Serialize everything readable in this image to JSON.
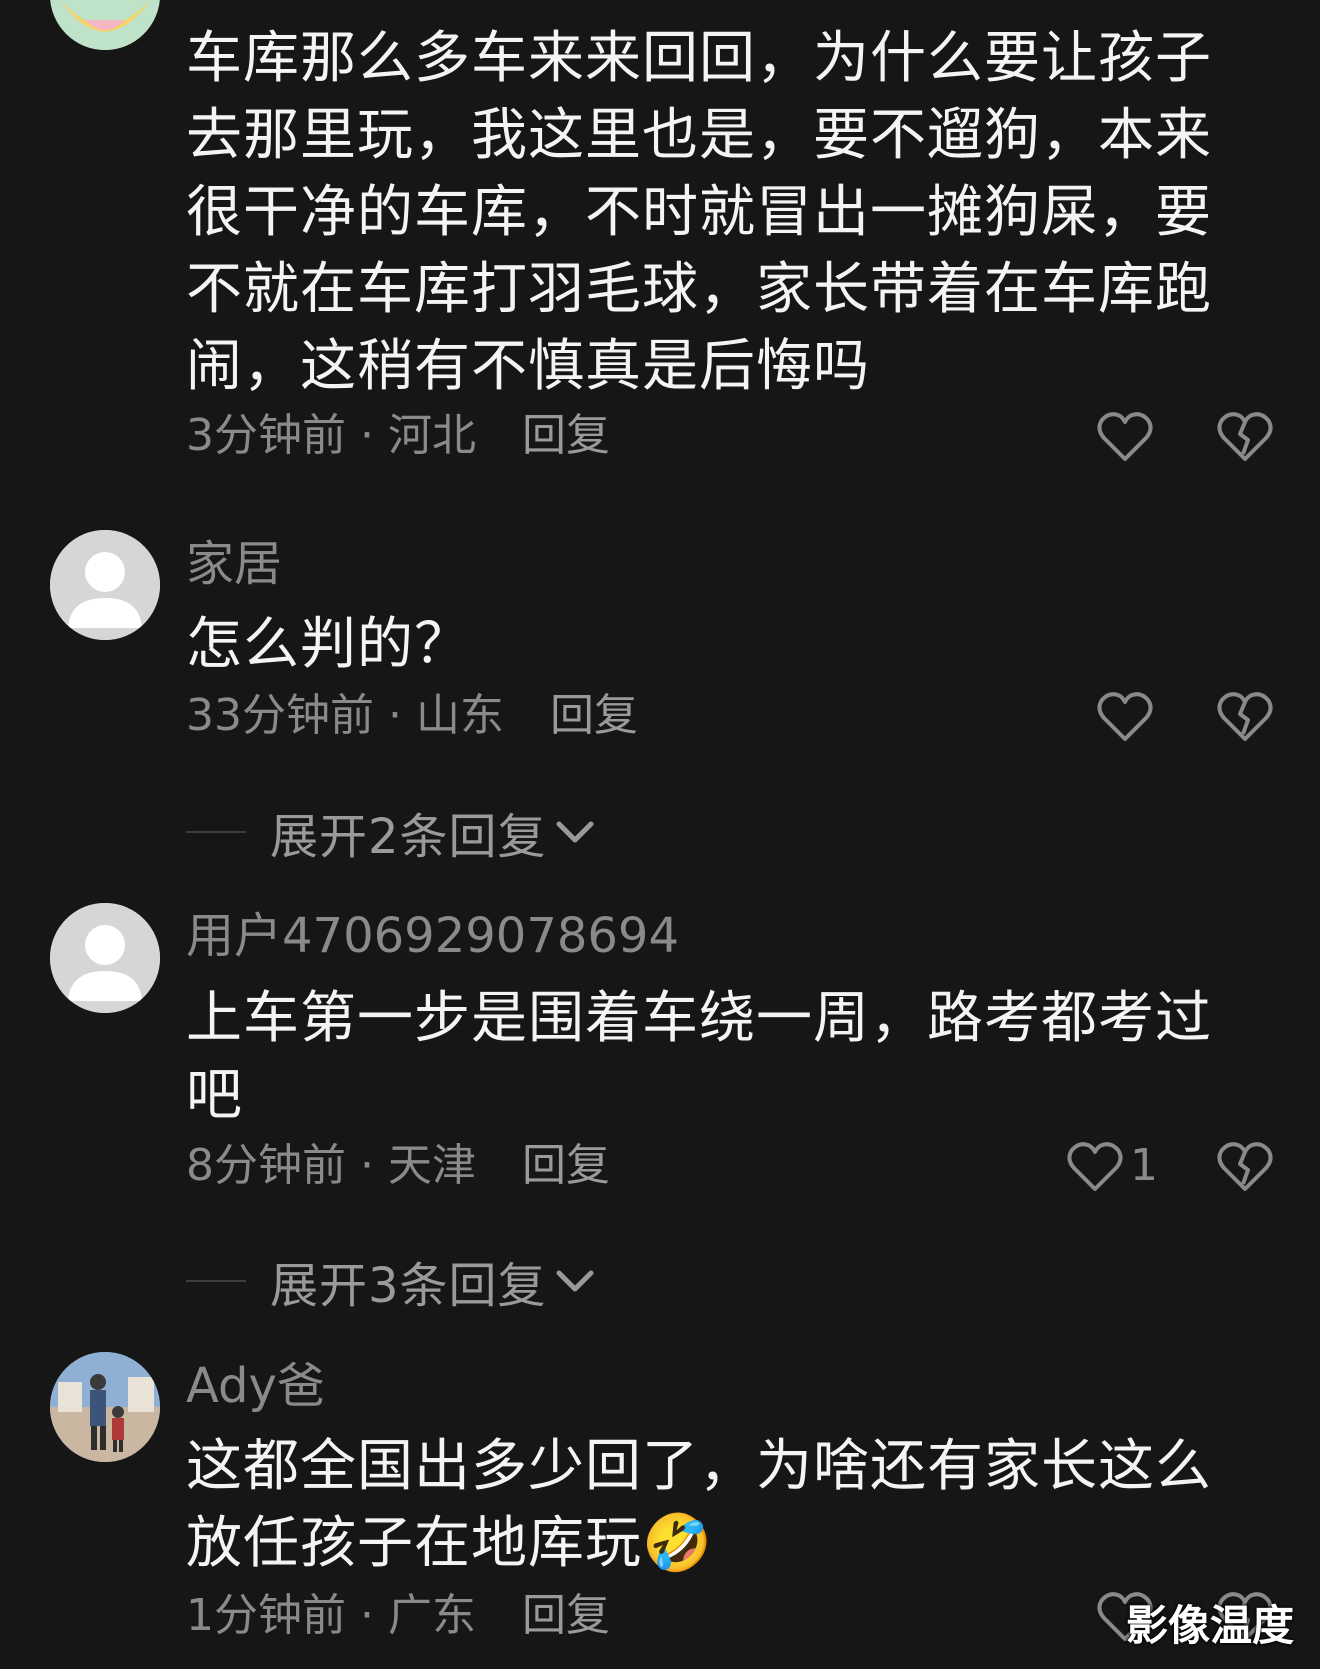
{
  "comments": [
    {
      "username": "",
      "text": "车库那么多车来来回回，为什么要让孩子去那里玩，我这里也是，要不遛狗，本来很干净的车库，不时就冒出一摊狗屎，要不就在车库打羽毛球，家长带着在车库跑闹，这稍有不慎真是后悔吗",
      "meta": "3分钟前 · 河北",
      "reply": "回复",
      "likes": ""
    },
    {
      "username": "家居",
      "text": "怎么判的？",
      "meta": "33分钟前 · 山东",
      "reply": "回复",
      "likes": "",
      "expand": "展开2条回复"
    },
    {
      "username": "用户4706929078694",
      "text": "上车第一步是围着车绕一周，路考都考过吧",
      "meta": "8分钟前 · 天津",
      "reply": "回复",
      "likes": "1",
      "expand": "展开3条回复"
    },
    {
      "username": "Ady爸",
      "text": "这都全国出多少回了，为啥还有家长这么放任孩子在地库玩🤣",
      "meta": "1分钟前 · 广东",
      "reply": "回复",
      "likes": ""
    }
  ],
  "watermark": "影像温度",
  "colors": {
    "background": "#161616",
    "text": "#f4f4f4",
    "muted": "#8a8a8a"
  },
  "icons": {
    "like": "heart-outline-icon",
    "dislike": "broken-heart-icon",
    "expand": "chevron-down-icon"
  }
}
